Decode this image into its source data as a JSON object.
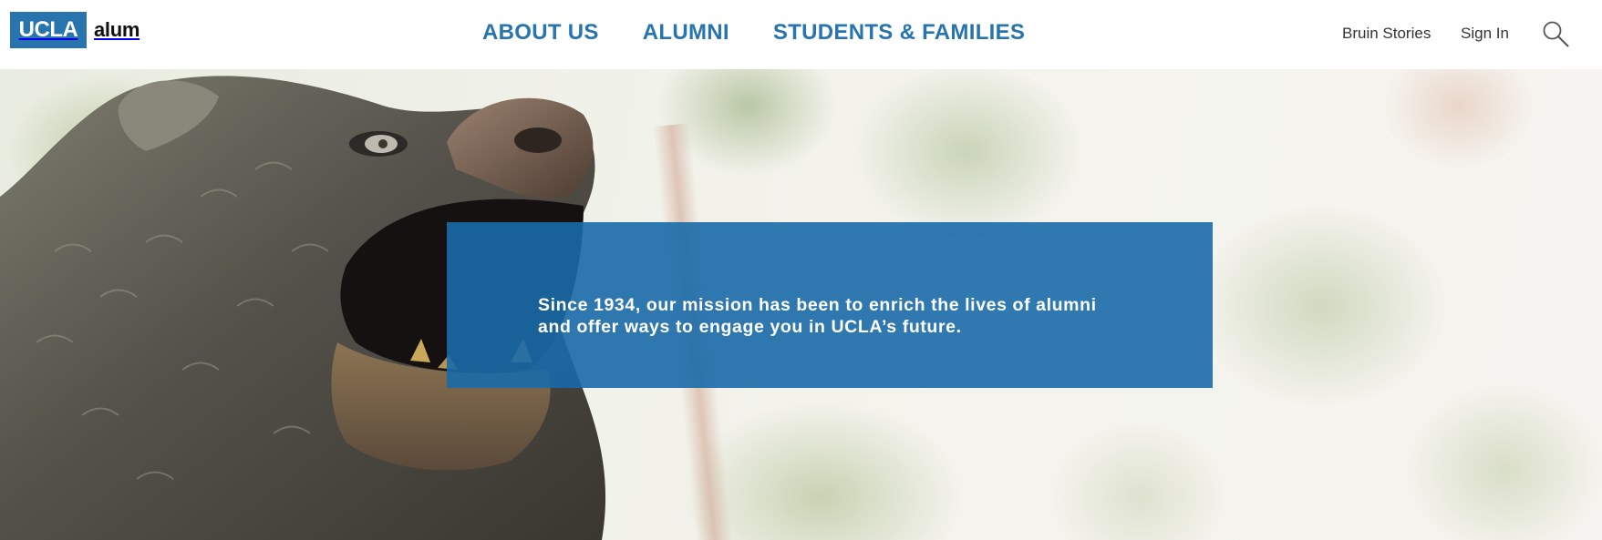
{
  "header": {
    "logo_mark": "UCLA",
    "logo_text": "alum",
    "main_nav": [
      {
        "label": "ABOUT US"
      },
      {
        "label": "ALUMNI"
      },
      {
        "label": "STUDENTS & FAMILIES"
      }
    ],
    "utility_nav": {
      "bruin_stories": "Bruin Stories",
      "sign_in": "Sign In",
      "search_icon": "search-icon"
    }
  },
  "hero": {
    "image": "bruin-bear-statue",
    "mission_text": "Since 1934, our mission has been to enrich the lives of alumni and offer ways to engage you in UCLA’s future."
  },
  "colors": {
    "brand_blue": "#2774ae",
    "mission_box": "#1a6aa8",
    "text_dark": "#333333"
  }
}
